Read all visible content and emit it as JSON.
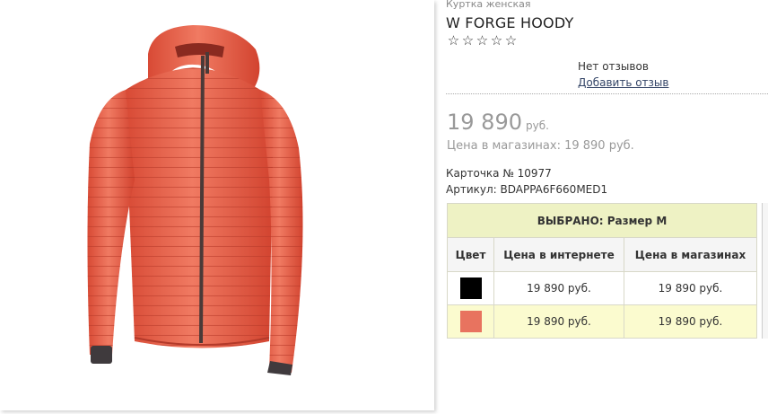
{
  "product": {
    "category": "Куртка женская",
    "name": "W FORGE HOODY",
    "stars": [
      "☆",
      "☆",
      "☆",
      "☆",
      "☆"
    ],
    "jacket_color": "#e86149"
  },
  "reviews": {
    "none_label": "Нет отзывов",
    "add_label": "Добавить отзыв"
  },
  "price": {
    "amount": "19 890",
    "currency": "руб.",
    "store_price": "Цена в магазинах: 19 890 руб."
  },
  "details": {
    "card_no": "Карточка № 10977",
    "sku": "Артикул: BDAPPA6F660MED1"
  },
  "variants": {
    "selected_label": "ВЫБРАНО:  Размер M",
    "columns": [
      "Цвет",
      "Цена в интернете",
      "Цена в магазинах"
    ],
    "rows": [
      {
        "color": "#000000",
        "online": "19 890 руб.",
        "store": "19 890 руб."
      },
      {
        "color": "#e8735f",
        "online": "19 890 руб.",
        "store": "19 890 руб."
      }
    ]
  }
}
